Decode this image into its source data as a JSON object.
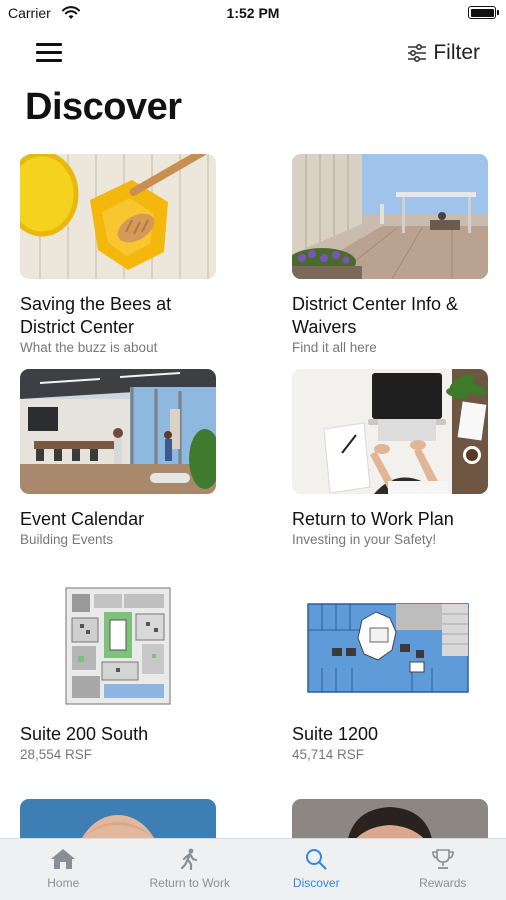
{
  "status_bar": {
    "carrier": "Carrier",
    "time": "1:52 PM"
  },
  "header": {
    "filter_label": "Filter",
    "title": "Discover"
  },
  "cards": [
    {
      "title": "Saving the Bees at District Center",
      "subtitle": "What the buzz is about"
    },
    {
      "title": "District Center Info & Waivers",
      "subtitle": "Find it all here"
    },
    {
      "title": "Event Calendar",
      "subtitle": "Building Events"
    },
    {
      "title": "Return to Work Plan",
      "subtitle": "Investing in your Safety!"
    },
    {
      "title": "Suite 200 South",
      "subtitle": "28,554 RSF"
    },
    {
      "title": "Suite 1200",
      "subtitle": "45,714 RSF"
    }
  ],
  "tabs": [
    {
      "label": "Home",
      "icon": "home-icon",
      "active": false
    },
    {
      "label": "Return to Work",
      "icon": "walking-person-icon",
      "active": false
    },
    {
      "label": "Discover",
      "icon": "search-icon",
      "active": true
    },
    {
      "label": "Rewards",
      "icon": "trophy-icon",
      "active": false
    }
  ],
  "colors": {
    "accent": "#2f88e8",
    "inactive_tab": "#8a8f96",
    "tab_bar_bg": "#eef0f2"
  }
}
